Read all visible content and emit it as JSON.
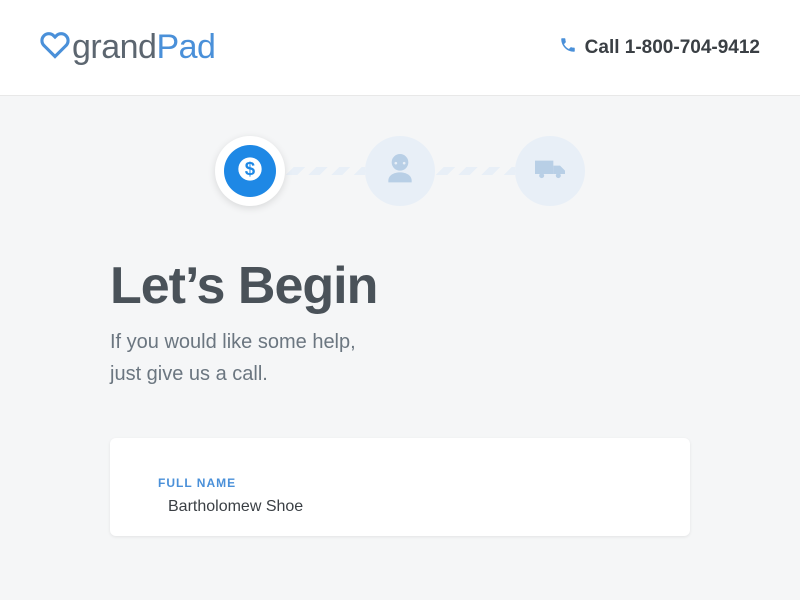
{
  "header": {
    "logo_grand": "grand",
    "logo_pad": "Pad",
    "phone_label": "Call 1-800-704-9412"
  },
  "progress": {
    "steps": [
      {
        "name": "payment",
        "icon": "dollar-icon",
        "active": true
      },
      {
        "name": "user",
        "icon": "person-icon",
        "active": false
      },
      {
        "name": "shipping",
        "icon": "truck-icon",
        "active": false
      }
    ]
  },
  "page": {
    "title": "Let’s Begin",
    "subtitle_line1": "If you would like some help,",
    "subtitle_line2": "just give us a call."
  },
  "form": {
    "full_name_label": "FULL NAME",
    "full_name_value": "Bartholomew Shoe"
  }
}
